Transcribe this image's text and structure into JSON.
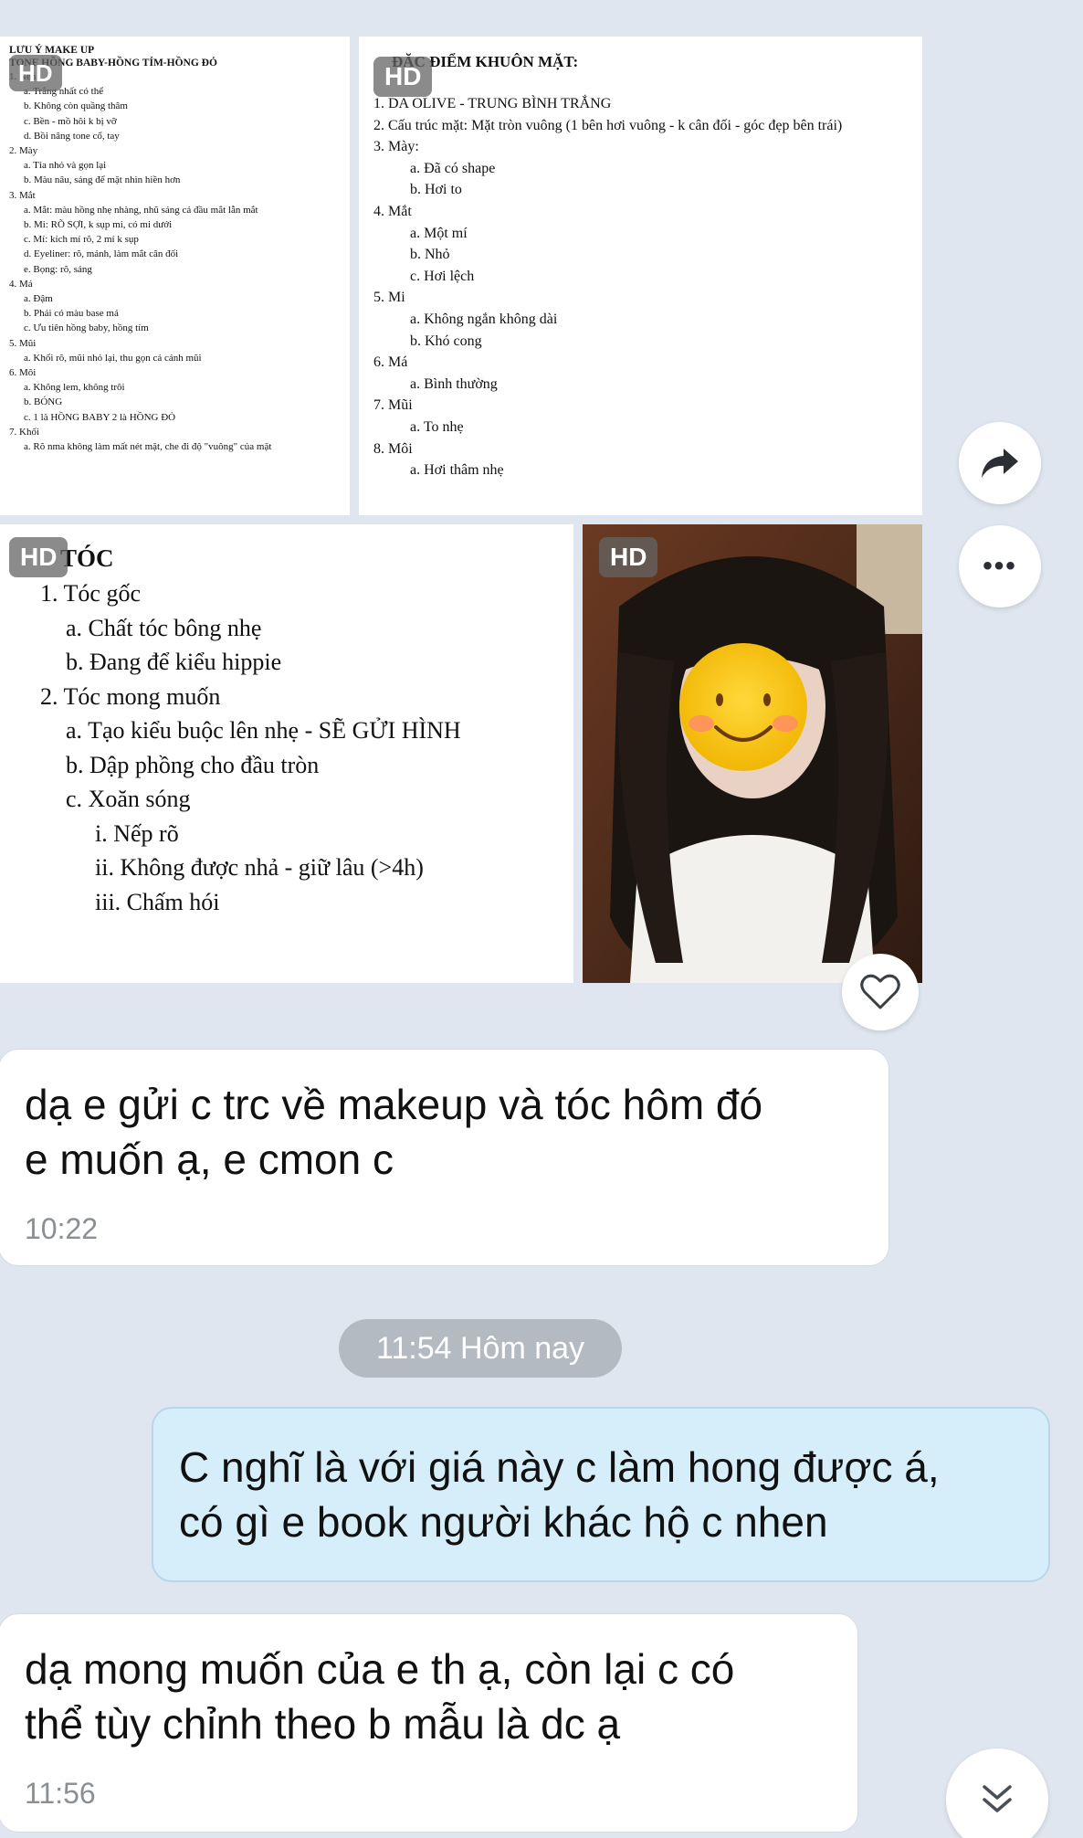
{
  "hd_label": "HD",
  "makeup_doc": {
    "title1": "LƯU Ý MAKE UP",
    "title2": "TONE HỒNG BABY-HỒNG TÍM-HỒNG ĐỎ",
    "lines": [
      {
        "text": "1. Nền",
        "indent": 0
      },
      {
        "text": "a. Trắng nhất có thể",
        "indent": 1
      },
      {
        "text": "b. Không còn quầng thâm",
        "indent": 1
      },
      {
        "text": "c. Bền - mồ hôi k bị vỡ",
        "indent": 1
      },
      {
        "text": "d. Bồi nâng tone cổ, tay",
        "indent": 1
      },
      {
        "text": "2. Mày",
        "indent": 0
      },
      {
        "text": "a. Tỉa nhỏ và gọn lại",
        "indent": 1
      },
      {
        "text": "b. Màu nâu, sáng để mặt nhìn hiền hơn",
        "indent": 1
      },
      {
        "text": "3. Mắt",
        "indent": 0
      },
      {
        "text": "a. Mắt: màu hồng nhẹ nhàng, nhũ sáng cả đầu mắt lẫn mắt",
        "indent": 1
      },
      {
        "text": "b. Mi: RÕ SỢI, k sụp mi, có mi dưới",
        "indent": 1
      },
      {
        "text": "c. Mí: kích mí rõ, 2 mí k sụp",
        "indent": 1
      },
      {
        "text": "d. Eyeliner: rõ, mảnh, làm mắt cân đối",
        "indent": 1
      },
      {
        "text": "e. Bọng: rõ, sáng",
        "indent": 1
      },
      {
        "text": "4. Má",
        "indent": 0
      },
      {
        "text": "a. Đậm",
        "indent": 1
      },
      {
        "text": "b. Phải có màu base má",
        "indent": 1
      },
      {
        "text": "c. Ưu tiên hồng baby, hồng tím",
        "indent": 1
      },
      {
        "text": "5. Mũi",
        "indent": 0
      },
      {
        "text": "a. Khối rõ, mũi nhỏ lại, thu gọn cả cánh mũi",
        "indent": 1
      },
      {
        "text": "6. Môi",
        "indent": 0
      },
      {
        "text": "a. Không lem, không trôi",
        "indent": 1
      },
      {
        "text": "b. BÓNG",
        "indent": 1
      },
      {
        "text": "c. 1 là HỒNG BABY 2 là HỒNG ĐỎ",
        "indent": 1
      },
      {
        "text": "7. Khối",
        "indent": 0
      },
      {
        "text": "a. Rõ nma không làm mất nét mặt, che đi độ \"vuông\" của mặt",
        "indent": 1
      }
    ]
  },
  "face_doc": {
    "title": "ĐẶC ĐIỂM KHUÔN MẶT:",
    "lines": [
      {
        "text": "1. DA OLIVE - TRUNG BÌNH TRẮNG",
        "indent": 0
      },
      {
        "text": "2. Cấu trúc mặt: Mặt tròn vuông (1 bên hơi vuông - k cân đối - góc đẹp bên trái)",
        "indent": 0
      },
      {
        "text": "3. Mày:",
        "indent": 0
      },
      {
        "text": "a. Đã có shape",
        "indent": 1
      },
      {
        "text": "b. Hơi to",
        "indent": 1
      },
      {
        "text": "4. Mắt",
        "indent": 0
      },
      {
        "text": "a. Một mí",
        "indent": 1
      },
      {
        "text": "b. Nhỏ",
        "indent": 1
      },
      {
        "text": "c. Hơi lệch",
        "indent": 1
      },
      {
        "text": "5. Mi",
        "indent": 0
      },
      {
        "text": "a. Không ngắn không dài",
        "indent": 1
      },
      {
        "text": "b. Khó cong",
        "indent": 1
      },
      {
        "text": "6. Má",
        "indent": 0
      },
      {
        "text": "a. Bình thường",
        "indent": 1
      },
      {
        "text": "7. Mũi",
        "indent": 0
      },
      {
        "text": "a. To nhẹ",
        "indent": 1
      },
      {
        "text": "8. Môi",
        "indent": 0
      },
      {
        "text": "a. Hơi thâm nhẹ",
        "indent": 1
      }
    ]
  },
  "hair_doc": {
    "title": "TÓC",
    "lines": [
      {
        "text": "1. Tóc gốc",
        "indent": 0
      },
      {
        "text": "a. Chất tóc bông nhẹ",
        "indent": 1
      },
      {
        "text": "b. Đang để kiểu hippie",
        "indent": 1
      },
      {
        "text": "2. Tóc mong muốn",
        "indent": 0
      },
      {
        "text": "a. Tạo kiểu buộc lên nhẹ - SẼ GỬI HÌNH",
        "indent": 1
      },
      {
        "text": "b. Dập phồng cho đầu tròn",
        "indent": 1
      },
      {
        "text": "c. Xoăn sóng",
        "indent": 1
      },
      {
        "text": "i. Nếp rõ",
        "indent": 2
      },
      {
        "text": "ii. Không được nhả - giữ lâu (>4h)",
        "indent": 2
      },
      {
        "text": "iii. Chấm hói",
        "indent": 2
      }
    ]
  },
  "actions": {
    "forward_icon": "share-arrow-icon",
    "more_icon": "more-dots-icon",
    "like_icon": "heart-icon",
    "scroll_icon": "double-chevron-down-icon",
    "more_label": "•••"
  },
  "messages": [
    {
      "direction": "in",
      "lines": [
        "dạ e gửi c trc về makeup và tóc hôm đó",
        "e muốn ạ, e cmon c"
      ],
      "time": "10:22"
    },
    {
      "direction": "out",
      "lines": [
        "C nghĩ là với giá này c làm hong được á,",
        "có gì e book người khác hộ c nhen"
      ]
    },
    {
      "direction": "in",
      "lines": [
        "dạ mong muốn của e th ạ, còn lại c có",
        "thể tùy chỉnh theo b mẫu là dc ạ"
      ],
      "time": "11:56"
    }
  ],
  "date_separator": "11:54 Hôm nay",
  "colors": {
    "background": "#dfe6ef",
    "outgoing_bubble": "#d6eefa",
    "incoming_bubble": "#ffffff",
    "date_pill": "#b4bac1"
  }
}
